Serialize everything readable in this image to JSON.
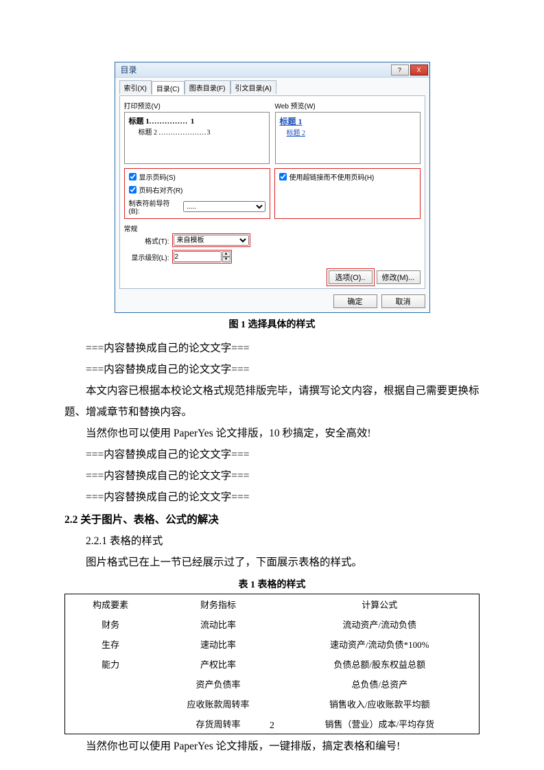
{
  "dialog": {
    "title": "目录",
    "help_btn": "?",
    "close_btn": "X",
    "tabs": [
      "索引(X)",
      "目录(C)",
      "图表目录(F)",
      "引文目录(A)"
    ],
    "active_tab": 1,
    "print_preview_label": "打印预览(V)",
    "web_preview_label": "Web 预览(W)",
    "print_preview": {
      "h1": "标题 1",
      "h1_page": "1",
      "h2": "标题 2",
      "h2_page": "3"
    },
    "web_preview": {
      "h1": "标题 1",
      "h2": "标题 2"
    },
    "show_pagenum_label": "显示页码(S)",
    "right_align_label": "页码右对齐(R)",
    "leader_label": "制表符前导符(B):",
    "leader_value": ".....",
    "hyperlink_label": "使用超链接而不使用页码(H)",
    "general_label": "常规",
    "format_label": "格式(T):",
    "format_value": "来自模板",
    "levels_label": "显示级别(L):",
    "levels_value": "2",
    "options_btn": "选项(O)..",
    "modify_btn": "修改(M)...",
    "ok_btn": "确定",
    "cancel_btn": "取消"
  },
  "fig1_caption": "图 1 选择具体的样式",
  "paras": [
    "===内容替换成自己的论文文字===",
    "===内容替换成自己的论文文字===",
    "本文内容已根据本校论文格式规范排版完毕，请撰写论文内容，根据自己需要更换标题、增减章节和替换内容。",
    "当然你也可以使用 PaperYes 论文排版，10 秒搞定，安全高效!",
    "===内容替换成自己的论文文字===",
    "===内容替换成自己的论文文字===",
    "===内容替换成自己的论文文字==="
  ],
  "h2_2": "2.2 关于图片、表格、公式的解决",
  "h3_221": "2.2.1  表格的样式",
  "para_tbl_intro": "图片格式已在上一节已经展示过了，下面展示表格的样式。",
  "tbl_caption": "表 1  表格的样式",
  "table": {
    "headers": [
      "构成要素",
      "财务指标",
      "计算公式"
    ],
    "rows": [
      [
        "财务",
        "流动比率",
        "流动资产/流动负债"
      ],
      [
        "生存",
        "速动比率",
        "速动资产/流动负债*100%"
      ],
      [
        "能力",
        "产权比率",
        "负债总额/股东权益总额"
      ],
      [
        "",
        "资产负债率",
        "总负债/总资产"
      ],
      [
        "",
        "应收账款周转率",
        "销售收入/应收账款平均额"
      ],
      [
        "",
        "存货周转率",
        "销售（营业）成本/平均存货"
      ]
    ]
  },
  "para_after_tbl": "当然你也可以使用 PaperYes 论文排版，一键排版，搞定表格和编号!",
  "page_number": "2"
}
